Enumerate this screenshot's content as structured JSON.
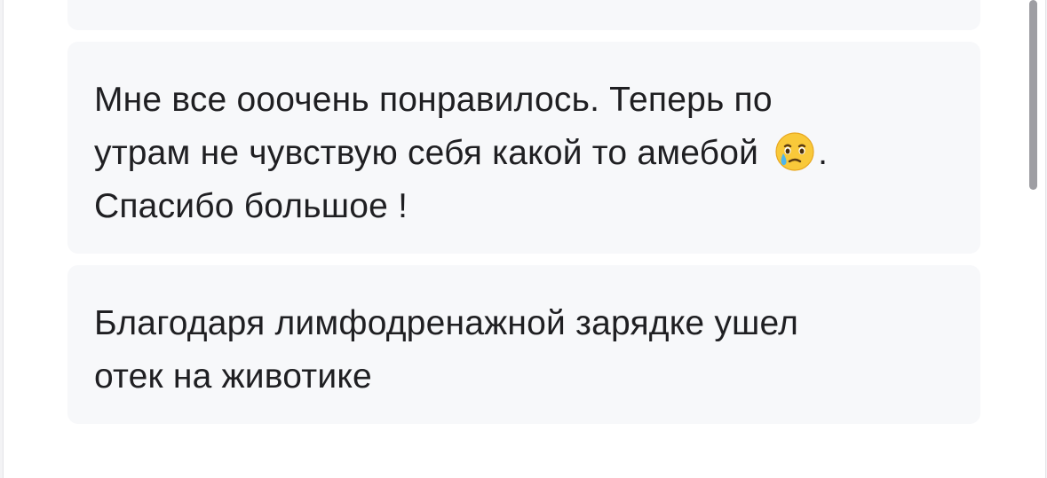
{
  "reviews": [
    {
      "text_before_emoji": "Мне все ооочень понравилось. Теперь по\nутрам не чувствую себя какой то амебой ",
      "emoji_icon": "face-holding-back-tears-icon",
      "text_after_emoji": ".\nСпасибо большое !"
    },
    {
      "text": "Благодаря лимфодренажной зарядке ушел\nотек на животике"
    }
  ],
  "colors": {
    "page_background": "#ffffff",
    "card_background": "#f7f8fa",
    "text": "#1f1f22",
    "scrollbar_thumb": "#9e9ea3"
  }
}
